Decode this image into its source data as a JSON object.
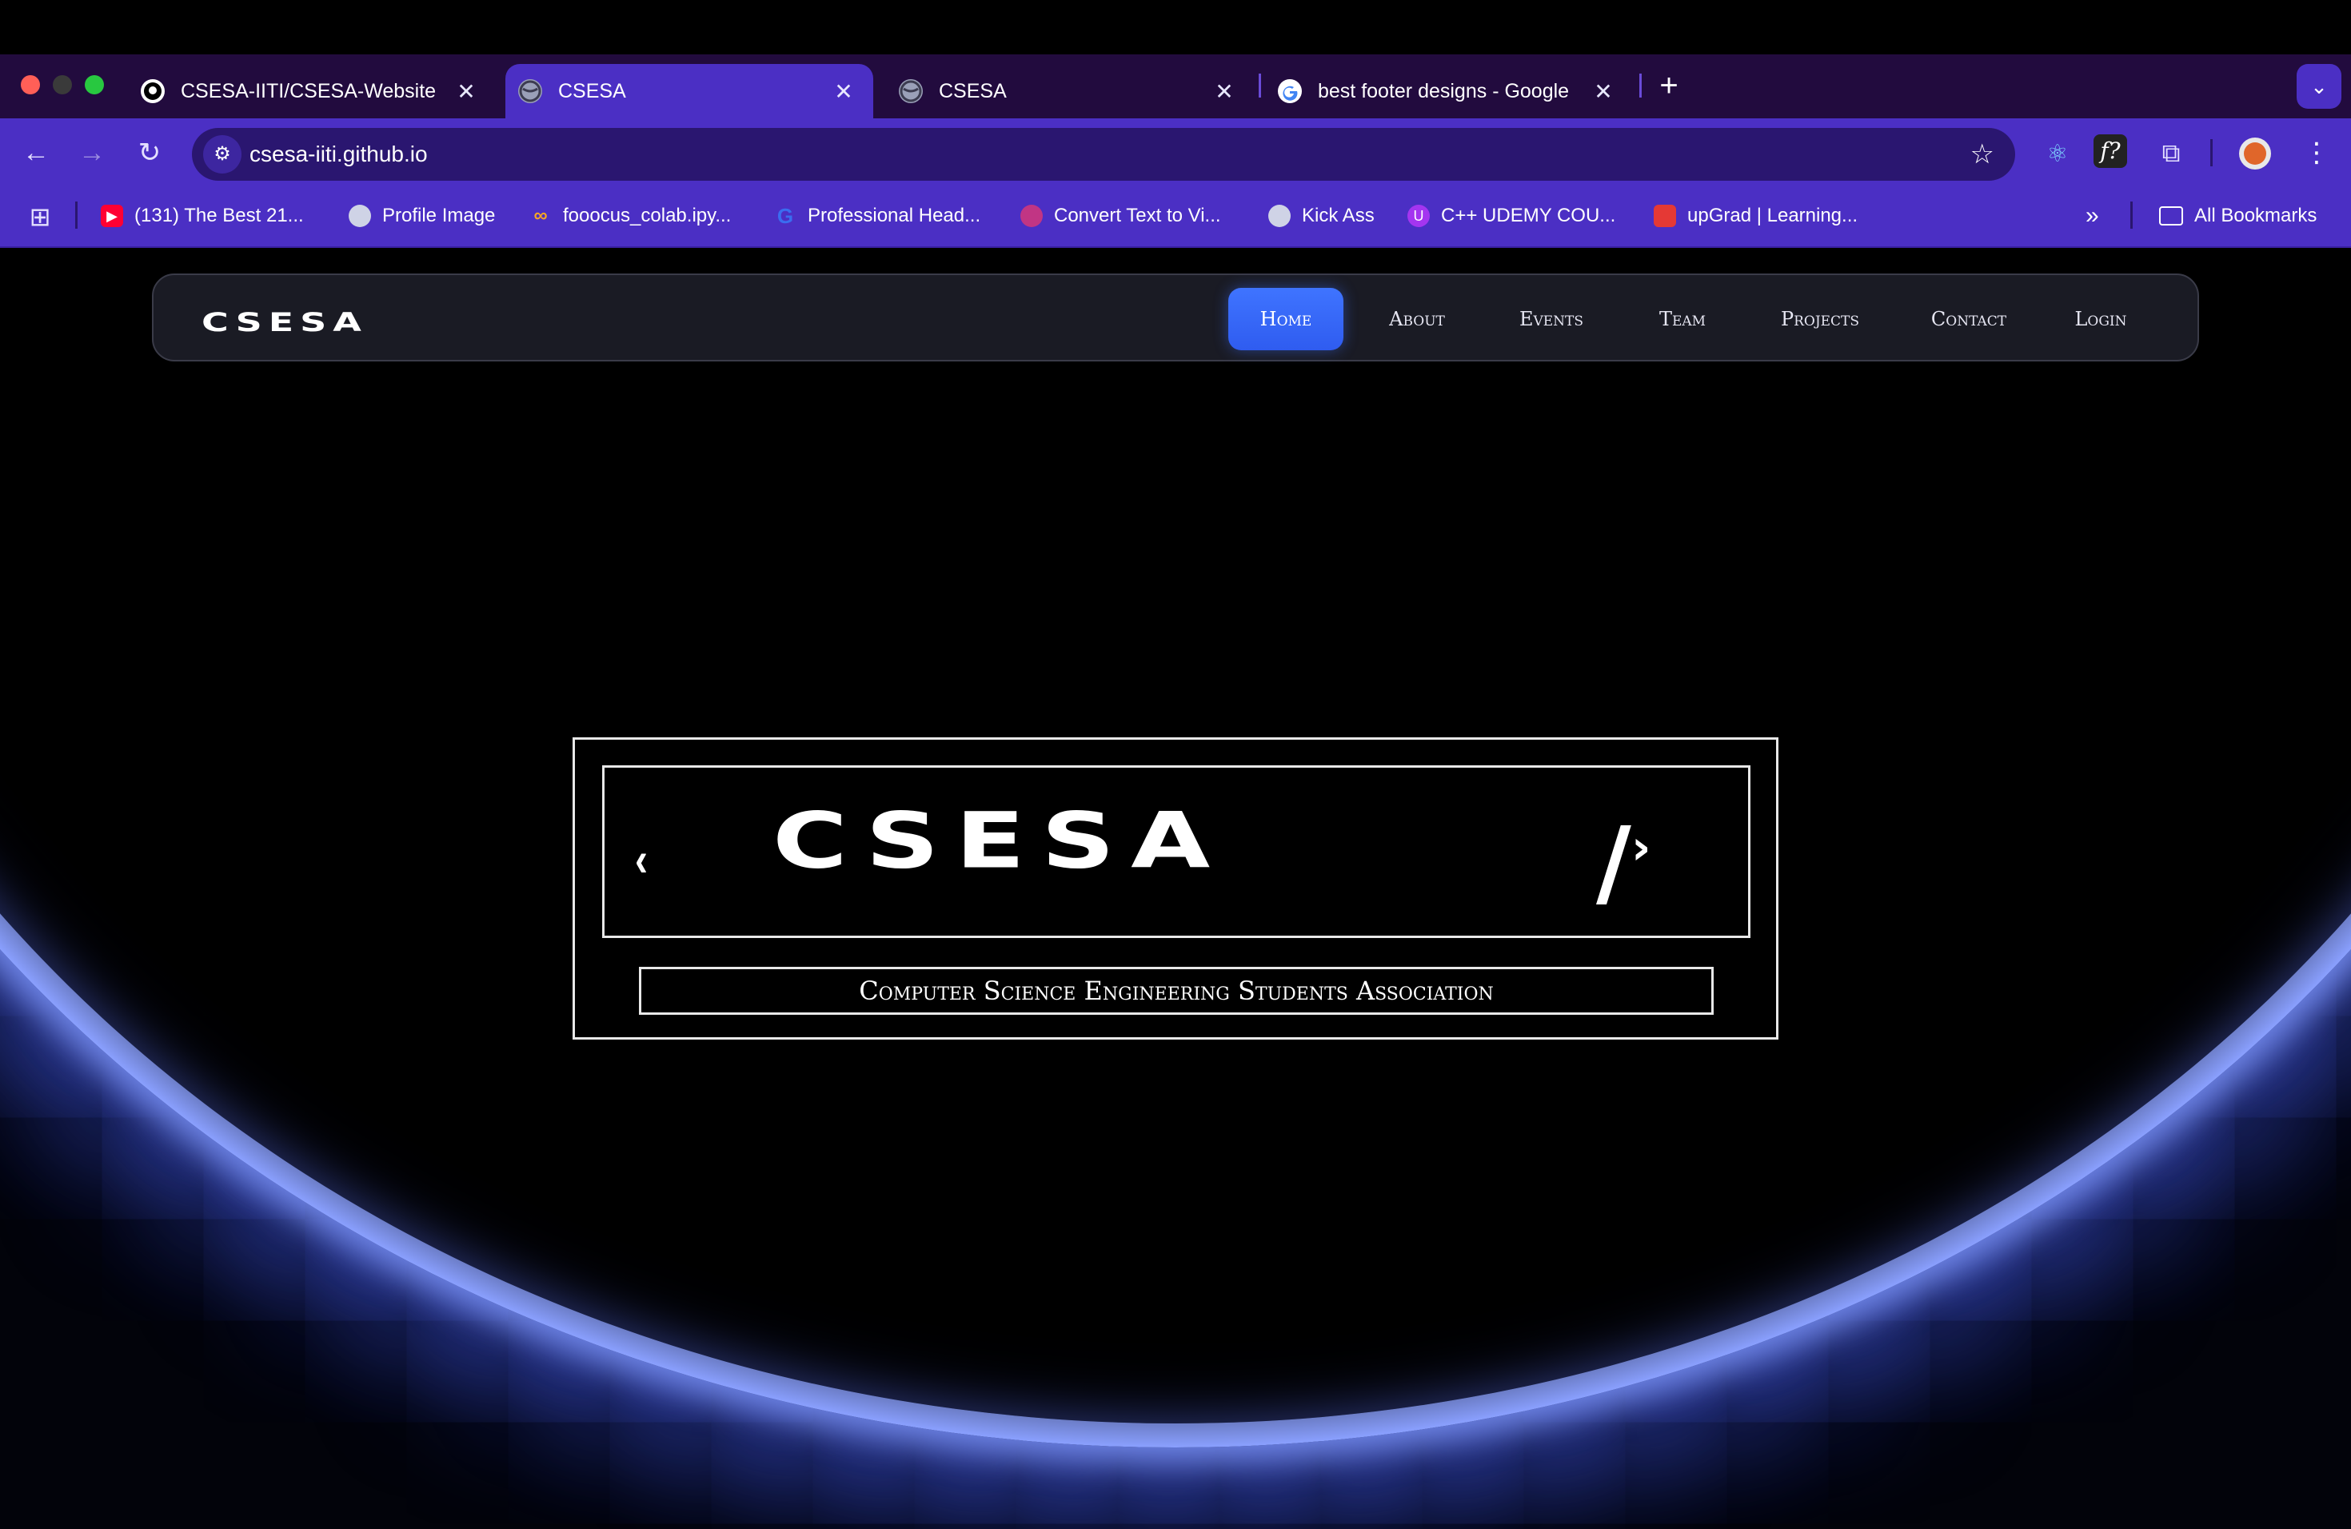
{
  "browser": {
    "tabs": [
      {
        "title": "CSESA-IITI/CSESA-Website",
        "icon": "github-icon",
        "active": false
      },
      {
        "title": "CSESA",
        "icon": "globe-icon",
        "active": true
      },
      {
        "title": "CSESA",
        "icon": "globe-icon",
        "active": false
      },
      {
        "title": "best footer designs - Google",
        "icon": "google-icon",
        "active": false
      }
    ],
    "new_tab_label": "+",
    "url": "csesa-iiti.github.io",
    "bookmarks": [
      {
        "label": "(131) The Best 21...",
        "icon": "youtube-icon"
      },
      {
        "label": "Profile Image",
        "icon": "globe-icon"
      },
      {
        "label": "fooocus_colab.ipy...",
        "icon": "colab-icon"
      },
      {
        "label": "Professional Head...",
        "icon": "g-icon"
      },
      {
        "label": "Convert Text to Vi...",
        "icon": "app-icon"
      },
      {
        "label": "Kick Ass",
        "icon": "globe-icon"
      },
      {
        "label": "C++ UDEMY COU...",
        "icon": "udemy-icon"
      },
      {
        "label": "upGrad | Learning...",
        "icon": "upgrad-icon"
      }
    ],
    "all_bookmarks_label": "All Bookmarks",
    "colors": {
      "tabstrip": "#220b3e",
      "toolbar": "#4b2fc4",
      "omnibox": "#2a1670"
    }
  },
  "site": {
    "logo_text": "CSESA",
    "nav": [
      {
        "label": "Home",
        "active": true
      },
      {
        "label": "About",
        "active": false
      },
      {
        "label": "Events",
        "active": false
      },
      {
        "label": "Team",
        "active": false
      },
      {
        "label": "Projects",
        "active": false
      },
      {
        "label": "Contact",
        "active": false
      },
      {
        "label": "Login",
        "active": false
      }
    ],
    "hero": {
      "left_glyph": "‹",
      "logo_text": "CSESA",
      "right_glyph": "/",
      "right_chevron": "›",
      "subtitle": "Computer Science Engineering Students Association"
    },
    "colors": {
      "accent": "#3f74ff",
      "glow": "#8aa0ff",
      "background": "#02030a"
    }
  }
}
